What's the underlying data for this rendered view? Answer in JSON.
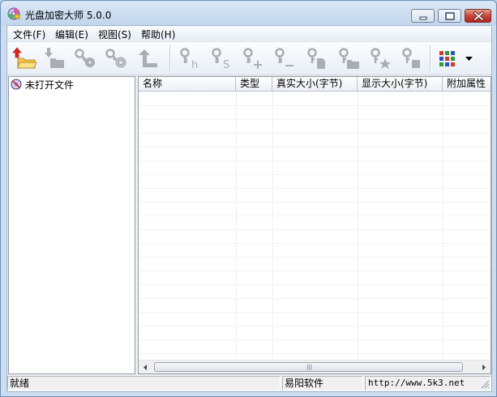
{
  "window": {
    "title": "光盘加密大师 5.0.0",
    "icon": "disc-lock-app-icon",
    "controls": [
      "minimize-icon",
      "maximize-icon",
      "close-icon"
    ]
  },
  "menu": [
    {
      "label": "文件(F)"
    },
    {
      "label": "编辑(E)"
    },
    {
      "label": "视图(S)"
    },
    {
      "label": "帮助(H)"
    }
  ],
  "toolbar": {
    "buttons": [
      {
        "icon": "open-folder-icon",
        "enabled": true
      },
      {
        "icon": "extract-folder-icon",
        "enabled": false
      },
      {
        "icon": "key-disc-icon",
        "enabled": false
      },
      {
        "icon": "key-disc-2-icon",
        "enabled": false
      },
      {
        "icon": "up-level-icon",
        "enabled": false
      },
      {
        "icon": "key-hide-icon",
        "enabled": false
      },
      {
        "icon": "key-s-icon",
        "enabled": false
      },
      {
        "icon": "key-add-icon",
        "enabled": false
      },
      {
        "icon": "key-remove-icon",
        "enabled": false
      },
      {
        "icon": "key-file-icon",
        "enabled": false
      },
      {
        "icon": "key-folder-icon",
        "enabled": false
      },
      {
        "icon": "key-star-icon",
        "enabled": false
      },
      {
        "icon": "key-stop-icon",
        "enabled": false
      },
      {
        "icon": "grid-view-icon",
        "enabled": true
      },
      {
        "icon": "dropdown-arrow-icon",
        "enabled": true
      }
    ],
    "colors": {
      "disabled_icon": "#a9aeb4",
      "grid_red": "#d23a2a",
      "grid_green": "#2e9a3a",
      "grid_blue": "#2a55c9",
      "open_arrow": "#e0261b",
      "open_folder": "#f5c542"
    }
  },
  "tree": {
    "root_label": "未打开文件",
    "root_icon": "no-disc-icon"
  },
  "list": {
    "columns": [
      "名称",
      "类型",
      "真实大小(字节)",
      "显示大小(字节)",
      "附加属性"
    ],
    "rows": []
  },
  "scrollbar": {
    "left_icon": "scroll-left-icon",
    "right_icon": "scroll-right-icon",
    "grip": "|||"
  },
  "status": {
    "message": "就绪",
    "company": "易阳软件",
    "url": "http://www.5k3.net"
  }
}
